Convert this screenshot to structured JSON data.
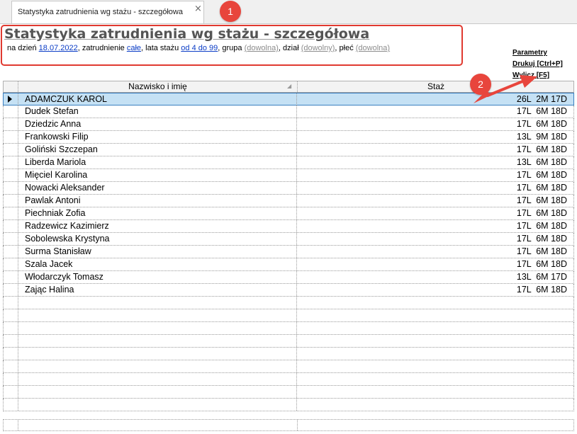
{
  "tab": {
    "label": "Statystyka zatrudnienia wg stażu - szczegółowa",
    "close": "×"
  },
  "badges": {
    "one": "1",
    "two": "2"
  },
  "header": {
    "title": "Statystyka zatrudnienia wg stażu - szczegółowa",
    "filters": {
      "prefix_date": "na dzień",
      "date": "18.07.2022",
      "sep_employment": ", zatrudnienie",
      "employment": "całe",
      "sep_seniority": ", lata stażu",
      "seniority": "od 4 do 99",
      "sep_group": ", grupa",
      "group": "(dowolna)",
      "sep_department": ", dział",
      "department": "(dowolny)",
      "sep_gender": ", płeć",
      "gender": "(dowolna)"
    }
  },
  "actions": {
    "parameters": "Parametry",
    "print": "Drukuj [Ctrl+P]",
    "compute": "Wylicz [F5]"
  },
  "grid": {
    "columns": {
      "name": "Nazwisko i imię",
      "seniority": "Staż"
    },
    "rows": [
      {
        "name": "ADAMCZUK KAROL",
        "staz": "26L  2M 17D",
        "selected": true
      },
      {
        "name": "Dudek Stefan",
        "staz": "17L  6M 18D"
      },
      {
        "name": "Dziedzic Anna",
        "staz": "17L  6M 18D"
      },
      {
        "name": "Frankowski Filip",
        "staz": "13L  9M 18D"
      },
      {
        "name": "Goliński Szczepan",
        "staz": "17L  6M 18D"
      },
      {
        "name": "Liberda Mariola",
        "staz": "13L  6M 18D"
      },
      {
        "name": "Mięciel Karolina",
        "staz": "17L  6M 18D"
      },
      {
        "name": "Nowacki Aleksander",
        "staz": "17L  6M 18D"
      },
      {
        "name": "Pawlak Antoni",
        "staz": "17L  6M 18D"
      },
      {
        "name": "Piechniak Zofia",
        "staz": "17L  6M 18D"
      },
      {
        "name": "Radzewicz Kazimierz",
        "staz": "17L  6M 18D"
      },
      {
        "name": "Sobolewska Krystyna",
        "staz": "17L  6M 18D"
      },
      {
        "name": "Surma Stanisław",
        "staz": "17L  6M 18D"
      },
      {
        "name": "Szala Jacek",
        "staz": "17L  6M 18D"
      },
      {
        "name": "Włodarczyk Tomasz",
        "staz": "13L  6M 17D"
      },
      {
        "name": "Zając Halina",
        "staz": "17L  6M 18D"
      }
    ],
    "empty_rows": 9
  },
  "colors": {
    "accent_red": "#e03a30",
    "link_blue": "#0a3cc6",
    "selected_row": "#c5e1f4"
  }
}
